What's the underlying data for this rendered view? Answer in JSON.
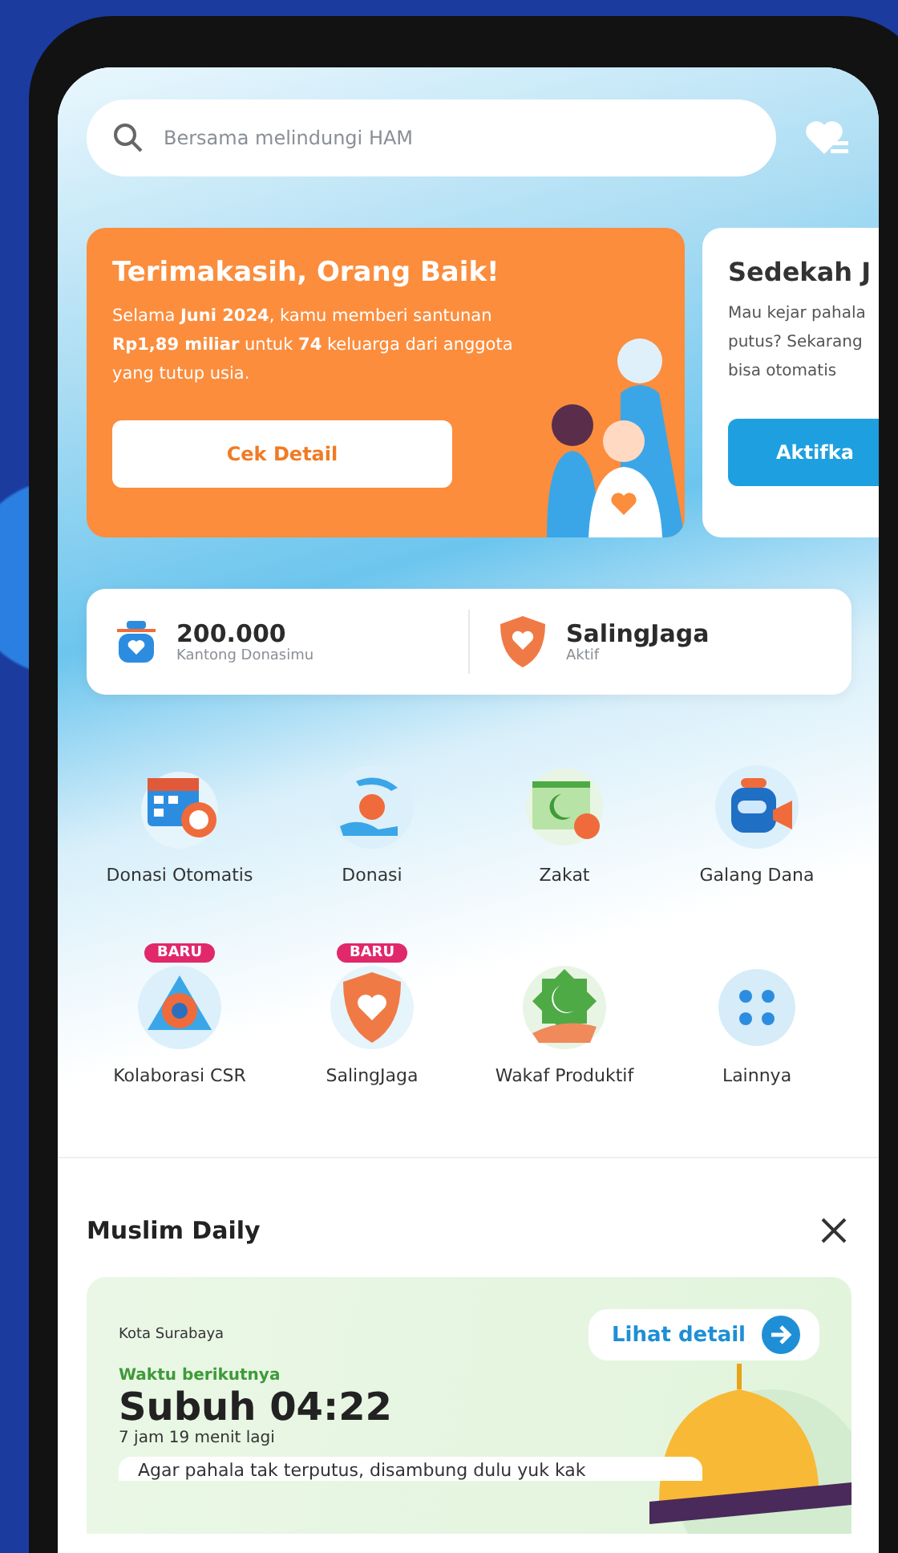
{
  "search": {
    "placeholder": "Bersama melindungi HAM"
  },
  "banners": [
    {
      "kind": "thanks",
      "title": "Terimakasih, Orang Baik!",
      "body": "Selama **Juni 2024**, kamu memberi santunan **Rp1,89 miliar** untuk **74** keluarga dari anggota yang tutup usia.",
      "button": "Cek Detail"
    },
    {
      "kind": "promo",
      "title": "Sedekah J",
      "lines": [
        "Mau kejar pahala",
        "putus? Sekarang",
        "bisa otomatis"
      ],
      "button": "Aktifka"
    }
  ],
  "wallet": {
    "amount": "200.000",
    "label": "Kantong Donasimu"
  },
  "protection": {
    "title": "SalingJaga",
    "status": "Aktif"
  },
  "menu": [
    {
      "label": "Donasi Otomatis"
    },
    {
      "label": "Donasi"
    },
    {
      "label": "Zakat"
    },
    {
      "label": "Galang Dana"
    },
    {
      "label": "Kolaborasi CSR",
      "badge": "BARU"
    },
    {
      "label": "SalingJaga",
      "badge": "BARU"
    },
    {
      "label": "Wakaf Produktif"
    },
    {
      "label": "Lainnya"
    }
  ],
  "muslim_daily": {
    "title": "Muslim Daily",
    "city": "Kota Surabaya",
    "link": "Lihat detail",
    "next_label": "Waktu berikutnya",
    "prayer": "Subuh 04:22",
    "countdown": "7 jam 19 menit lagi",
    "message": "Agar pahala tak terputus, disambung dulu yuk kak"
  }
}
